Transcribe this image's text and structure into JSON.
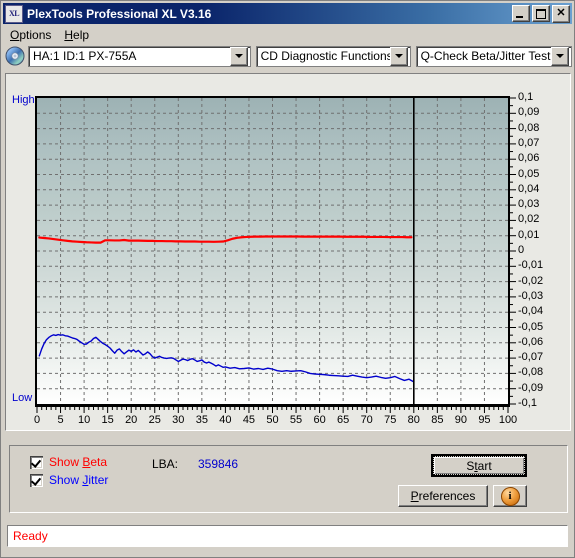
{
  "window": {
    "title": "PlexTools Professional XL V3.16",
    "icon": "XL",
    "buttons": {
      "minimize": "minimize-icon",
      "maximize": "maximize-icon",
      "close": "close-icon"
    }
  },
  "menu": {
    "items": [
      {
        "label": "Options",
        "accel": "O"
      },
      {
        "label": "Help",
        "accel": "H"
      }
    ]
  },
  "toolbar": {
    "disc_icon": "compact-disc-icon",
    "drive": {
      "value": "HA:1 ID:1  PX-755A",
      "options": [
        "HA:1 ID:1  PX-755A"
      ]
    },
    "function": {
      "value": "CD Diagnostic Functions",
      "options": [
        "CD Diagnostic Functions"
      ]
    },
    "test": {
      "value": "Q-Check Beta/Jitter Test",
      "options": [
        "Q-Check Beta/Jitter Test"
      ]
    }
  },
  "chart_data": {
    "type": "line",
    "title": "",
    "xlabel": "",
    "ylabel": "",
    "xlim": [
      0,
      100
    ],
    "ylim": [
      -0.1,
      0.1
    ],
    "grid": true,
    "legend": "none",
    "y_axis_side": "right",
    "axis_left_top_label": "High",
    "axis_left_bottom_label": "Low",
    "x_ticks": [
      0,
      5,
      10,
      15,
      20,
      25,
      30,
      35,
      40,
      45,
      50,
      55,
      60,
      65,
      70,
      75,
      80,
      85,
      90,
      95,
      100
    ],
    "x_minor_tick_step": 1,
    "y_ticks": [
      0.1,
      0.09,
      0.08,
      0.07,
      0.06,
      0.05,
      0.04,
      0.03,
      0.02,
      0.01,
      0,
      -0.01,
      -0.02,
      -0.03,
      -0.04,
      -0.05,
      -0.06,
      -0.07,
      -0.08,
      -0.09,
      -0.1
    ],
    "y_tick_labels": [
      "0,1",
      "0,09",
      "0,08",
      "0,07",
      "0,06",
      "0,05",
      "0,04",
      "0,03",
      "0,02",
      "0,01",
      "0",
      "-0,01",
      "-0,02",
      "-0,03",
      "-0,04",
      "-0,05",
      "-0,06",
      "-0,07",
      "-0,08",
      "-0,09",
      "-0,1"
    ],
    "data_end_marker_x": 80,
    "colors": {
      "beta": "#ff0000",
      "jitter": "#0000cc"
    },
    "series": [
      {
        "name": "Beta",
        "color": "#ff0000",
        "x": [
          0.5,
          1.5,
          2.5,
          3.5,
          4.5,
          5.5,
          6.5,
          7.5,
          8.5,
          9.5,
          10.5,
          11.5,
          12.5,
          13.5,
          14.5,
          15.5,
          16.5,
          17.5,
          18.5,
          19.5,
          20.5,
          21.5,
          22.5,
          23.5,
          24.5,
          25.5,
          26.5,
          27.5,
          28.5,
          29.5,
          30.5,
          31.5,
          32.5,
          33.5,
          34.5,
          35.5,
          36.5,
          37.5,
          38.5,
          39.5,
          40.5,
          41.5,
          42.5,
          43.5,
          44.5,
          45.5,
          46.5,
          47.5,
          48.5,
          49.5,
          50.5,
          51.5,
          52.5,
          53.5,
          54.5,
          55.5,
          56.5,
          57.5,
          58.5,
          59.5,
          60.5,
          61.5,
          62.5,
          63.5,
          64.5,
          65.5,
          66.5,
          67.5,
          68.5,
          69.5,
          70.5,
          71.5,
          72.5,
          73.5,
          74.5,
          75.5,
          76.5,
          77.5,
          78.5,
          79.5
        ],
        "y": [
          0.0088,
          0.0085,
          0.0082,
          0.0078,
          0.0074,
          0.007,
          0.0066,
          0.0063,
          0.0061,
          0.0059,
          0.0057,
          0.0056,
          0.0055,
          0.0055,
          0.007,
          0.007,
          0.0069,
          0.0069,
          0.0072,
          0.0068,
          0.0068,
          0.0068,
          0.0067,
          0.0066,
          0.0066,
          0.0065,
          0.0065,
          0.0064,
          0.0064,
          0.0063,
          0.0063,
          0.0062,
          0.0062,
          0.0062,
          0.0061,
          0.0061,
          0.0061,
          0.006,
          0.0061,
          0.0062,
          0.007,
          0.008,
          0.0086,
          0.009,
          0.0092,
          0.0093,
          0.0094,
          0.0094,
          0.0095,
          0.0095,
          0.0095,
          0.0095,
          0.0095,
          0.0095,
          0.0095,
          0.0095,
          0.0094,
          0.0094,
          0.0094,
          0.0094,
          0.0094,
          0.0094,
          0.0094,
          0.0094,
          0.0094,
          0.0093,
          0.0093,
          0.0093,
          0.0093,
          0.0093,
          0.0092,
          0.0092,
          0.0092,
          0.0092,
          0.0091,
          0.0091,
          0.0091,
          0.0091,
          0.009,
          0.009
        ]
      },
      {
        "name": "Jitter",
        "color": "#0000cc",
        "x": [
          0.5,
          1.0,
          1.5,
          2.0,
          2.5,
          3.0,
          3.5,
          4.0,
          4.5,
          5.0,
          5.5,
          6.0,
          6.5,
          7.0,
          7.5,
          8.0,
          8.5,
          9.0,
          9.5,
          10.0,
          10.5,
          11.0,
          11.5,
          12.0,
          12.5,
          13.0,
          13.5,
          14.0,
          14.5,
          15.0,
          15.5,
          16.0,
          16.5,
          17.0,
          17.5,
          18.0,
          18.5,
          19.0,
          19.5,
          20.0,
          20.5,
          21.0,
          21.5,
          22.0,
          22.5,
          23.0,
          23.5,
          24.0,
          24.5,
          25.0,
          25.5,
          26.0,
          26.5,
          27.0,
          27.5,
          28.0,
          28.5,
          29.0,
          29.5,
          30.0,
          30.5,
          31.0,
          31.5,
          32.0,
          32.5,
          33.0,
          33.5,
          34.0,
          34.5,
          35.0,
          35.5,
          36.0,
          36.5,
          37.0,
          37.5,
          38.0,
          38.5,
          39.0,
          39.5,
          40.0,
          41.0,
          42.0,
          43.0,
          44.0,
          45.0,
          46.0,
          47.0,
          48.0,
          49.0,
          50.0,
          51.0,
          52.0,
          53.0,
          54.0,
          55.0,
          56.0,
          57.0,
          58.0,
          59.0,
          60.0,
          61.0,
          62.0,
          63.0,
          64.0,
          65.0,
          66.0,
          67.0,
          68.0,
          69.0,
          70.0,
          71.0,
          72.0,
          73.0,
          74.0,
          75.0,
          76.0,
          77.0,
          78.0,
          79.0,
          79.8
        ],
        "y": [
          -0.0685,
          -0.064,
          -0.0605,
          -0.058,
          -0.0565,
          -0.0555,
          -0.0548,
          -0.0552,
          -0.0546,
          -0.055,
          -0.0548,
          -0.0554,
          -0.0556,
          -0.0562,
          -0.0568,
          -0.0572,
          -0.0578,
          -0.059,
          -0.06,
          -0.061,
          -0.0608,
          -0.0596,
          -0.0588,
          -0.0572,
          -0.0564,
          -0.0578,
          -0.0592,
          -0.0604,
          -0.0612,
          -0.0622,
          -0.0634,
          -0.0652,
          -0.0668,
          -0.0648,
          -0.064,
          -0.0658,
          -0.0672,
          -0.066,
          -0.0648,
          -0.0656,
          -0.0646,
          -0.066,
          -0.065,
          -0.0664,
          -0.068,
          -0.0672,
          -0.066,
          -0.0672,
          -0.069,
          -0.07,
          -0.0694,
          -0.0688,
          -0.0696,
          -0.07,
          -0.0702,
          -0.07,
          -0.0698,
          -0.0702,
          -0.0712,
          -0.0722,
          -0.0714,
          -0.0706,
          -0.071,
          -0.0716,
          -0.0708,
          -0.0704,
          -0.0712,
          -0.0722,
          -0.0718,
          -0.0712,
          -0.0726,
          -0.0732,
          -0.0726,
          -0.0734,
          -0.0742,
          -0.0752,
          -0.0744,
          -0.0752,
          -0.076,
          -0.0758,
          -0.0766,
          -0.0762,
          -0.077,
          -0.0768,
          -0.0764,
          -0.0772,
          -0.0768,
          -0.0774,
          -0.0766,
          -0.0772,
          -0.0782,
          -0.0786,
          -0.0782,
          -0.0786,
          -0.0784,
          -0.0782,
          -0.079,
          -0.08,
          -0.0804,
          -0.0806,
          -0.0808,
          -0.0812,
          -0.0814,
          -0.0816,
          -0.0818,
          -0.082,
          -0.0812,
          -0.0818,
          -0.0824,
          -0.0828,
          -0.0824,
          -0.0818,
          -0.0826,
          -0.0832,
          -0.0828,
          -0.082,
          -0.0834,
          -0.0846,
          -0.0838,
          -0.0852
        ]
      }
    ]
  },
  "options": {
    "show_beta": {
      "label": "Show Beta",
      "accel": "B",
      "checked": true,
      "color": "#ff0000"
    },
    "show_jitter": {
      "label": "Show Jitter",
      "accel": "J",
      "checked": true,
      "color": "#0000ff"
    },
    "lba_label": "LBA:",
    "lba_value": "359846",
    "start_button": {
      "label": "Start",
      "accel": "t"
    },
    "preferences_button": {
      "label": "Preferences",
      "accel": "P"
    },
    "info_button": {
      "icon": "info-icon",
      "glyph": "i"
    }
  },
  "status": {
    "text": "Ready",
    "color": "#ff0000"
  }
}
